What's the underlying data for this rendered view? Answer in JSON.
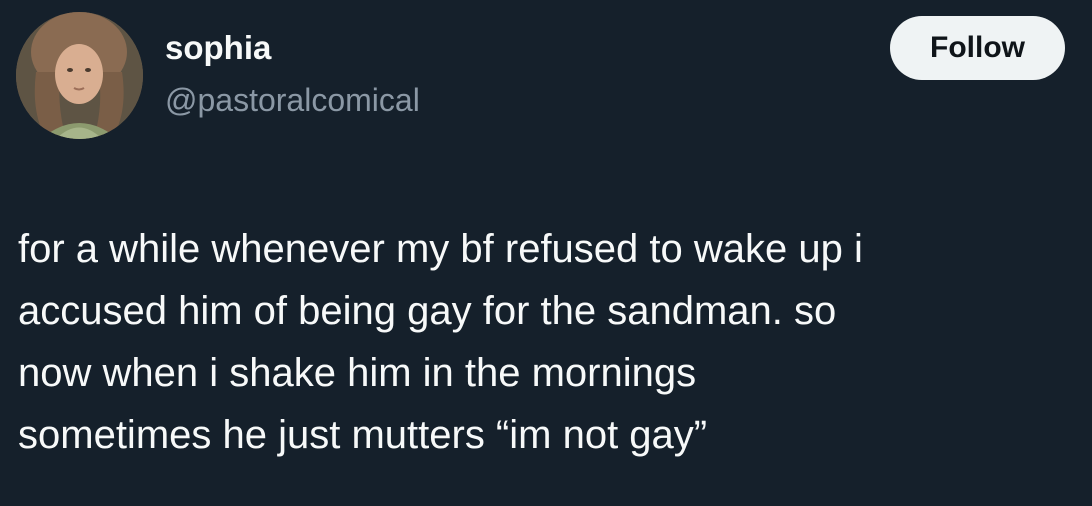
{
  "author": {
    "display_name": "sophia",
    "handle": "@pastoralcomical",
    "avatar_icon": "profile-photo"
  },
  "actions": {
    "follow_label": "Follow"
  },
  "tweet": {
    "lines": [
      "for a while whenever my bf refused to wake up i",
      "accused him of being gay for the sandman. so",
      "now when i shake him in the mornings",
      "sometimes he just mutters “im not gay”"
    ]
  },
  "colors": {
    "background": "#15202b",
    "text_primary": "#f7f9f9",
    "text_secondary": "#8b98a5",
    "button_bg": "#eff3f4",
    "button_text": "#0f1419"
  }
}
